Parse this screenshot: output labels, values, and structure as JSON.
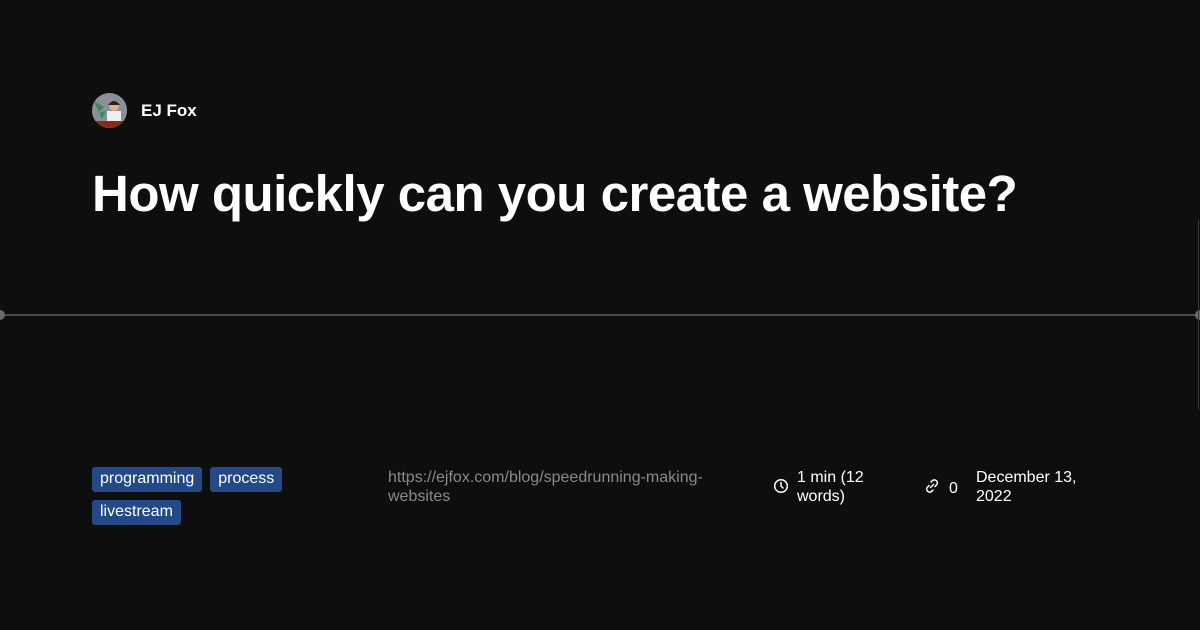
{
  "author": {
    "name": "EJ Fox"
  },
  "post": {
    "title": "How quickly can you create a website?",
    "tags": [
      "programming",
      "process",
      "livestream"
    ],
    "url": "https://ejfox.com/blog/speedrunning-making-websites",
    "reading_time": "1 min (12 words)",
    "links": "0",
    "date": "December 13, 2022"
  },
  "colors": {
    "background": "#0e0e0e",
    "tag": "#234a86"
  }
}
